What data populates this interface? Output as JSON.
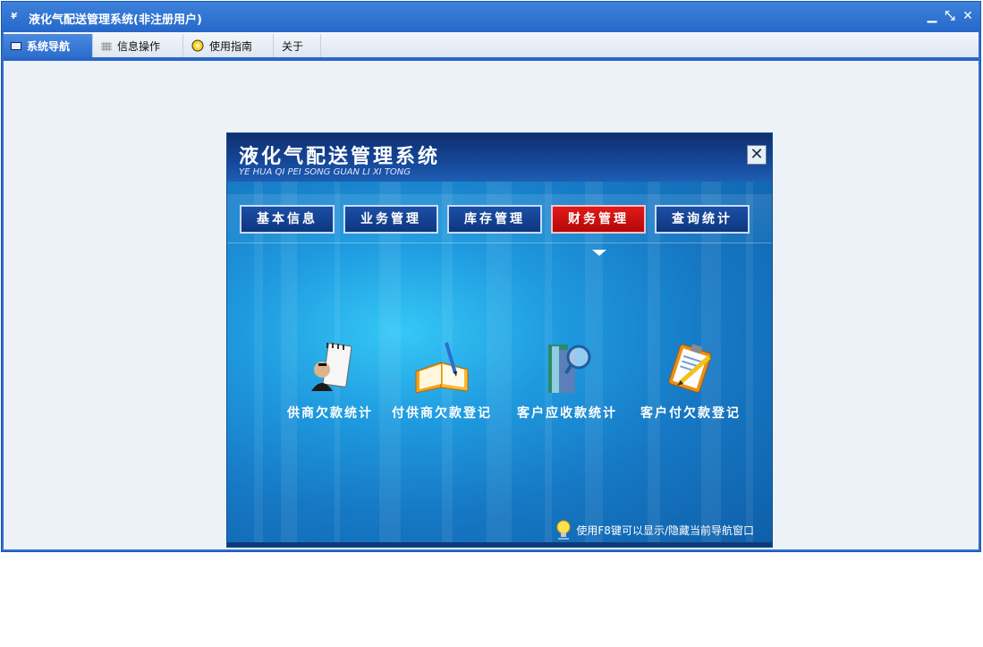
{
  "window": {
    "title": "液化气配送管理系统(非注册用户)",
    "controls": {
      "minimize": "▁",
      "restore": "⤡",
      "close": "✕"
    }
  },
  "menu": {
    "tabs": [
      {
        "label": "系统导航",
        "active": true
      },
      {
        "label": "信息操作",
        "active": false
      },
      {
        "label": "使用指南",
        "active": false
      },
      {
        "label": "关于",
        "active": false
      }
    ]
  },
  "panel": {
    "title": "液化气配送管理系统",
    "subtitle": "YE HUA QI PEI SONG GUAN LI XI TONG",
    "close_label": "✕",
    "nav_buttons": [
      {
        "label": "基本信息",
        "active": false
      },
      {
        "label": "业务管理",
        "active": false
      },
      {
        "label": "库存管理",
        "active": false
      },
      {
        "label": "财务管理",
        "active": true
      },
      {
        "label": "查询统计",
        "active": false
      }
    ],
    "functions": [
      {
        "label": "供商欠款统计",
        "icon": "notepad-person-icon"
      },
      {
        "label": "付供商欠款登记",
        "icon": "open-book-pen-icon"
      },
      {
        "label": "客户应收款统计",
        "icon": "book-magnifier-icon"
      },
      {
        "label": "客户付欠款登记",
        "icon": "clipboard-pencil-icon"
      }
    ],
    "tip": "使用F8键可以显示/隐藏当前导航窗口"
  },
  "colors": {
    "titlebar": "#2f6fcf",
    "active_nav": "#d01010",
    "nav": "#164494"
  }
}
